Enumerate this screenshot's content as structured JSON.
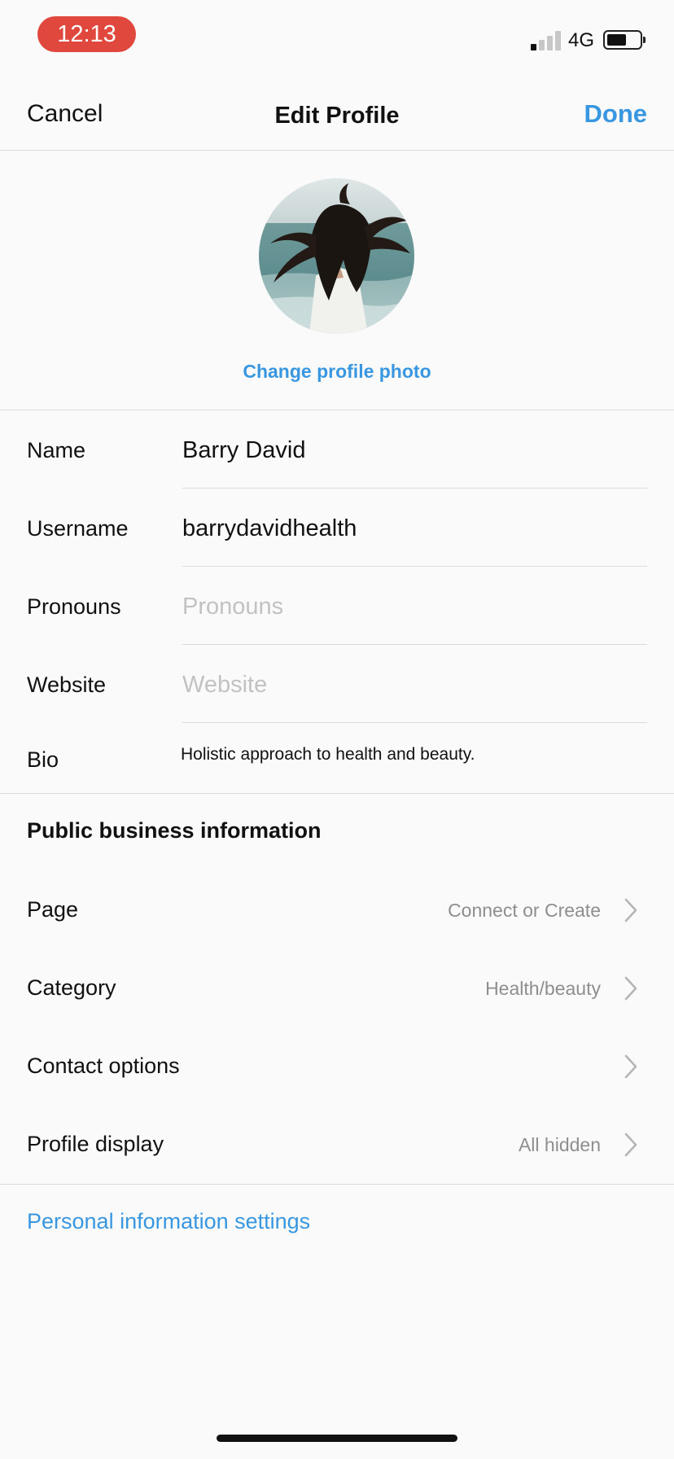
{
  "status_bar": {
    "time": "12:13",
    "network": "4G",
    "signal_bars_active": 1,
    "signal_bars_total": 4
  },
  "nav": {
    "cancel": "Cancel",
    "title": "Edit Profile",
    "done": "Done"
  },
  "profile": {
    "change_photo": "Change profile photo"
  },
  "form": {
    "name": {
      "label": "Name",
      "value": "Barry David",
      "placeholder": ""
    },
    "username": {
      "label": "Username",
      "value": "barrydavidhealth",
      "placeholder": ""
    },
    "pronouns": {
      "label": "Pronouns",
      "value": "",
      "placeholder": "Pronouns"
    },
    "website": {
      "label": "Website",
      "value": "",
      "placeholder": "Website"
    },
    "bio": {
      "label": "Bio",
      "value": "Holistic approach to health and beauty."
    }
  },
  "business": {
    "title": "Public business information",
    "rows": [
      {
        "label": "Page",
        "value": "Connect or Create"
      },
      {
        "label": "Category",
        "value": "Health/beauty"
      },
      {
        "label": "Contact options",
        "value": ""
      },
      {
        "label": "Profile display",
        "value": "All hidden"
      }
    ]
  },
  "personal_info_link": "Personal information settings",
  "colors": {
    "accent": "#3897e0",
    "time_pill": "#e0483e",
    "divider": "#dbdbdb",
    "secondary_text": "#8e8e8e"
  }
}
